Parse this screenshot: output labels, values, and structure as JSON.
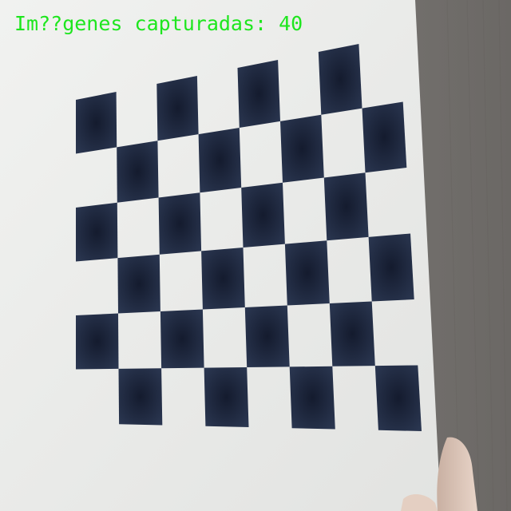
{
  "overlay": {
    "capture_label": "Im??genes capturadas: 40"
  },
  "colors": {
    "overlay_text": "#1ee61e",
    "square_dark": "#1c2740",
    "paper": "#ecedeb",
    "table_wood": "#7d7b79"
  },
  "checkerboard": {
    "rows": 6,
    "cols": 8
  }
}
